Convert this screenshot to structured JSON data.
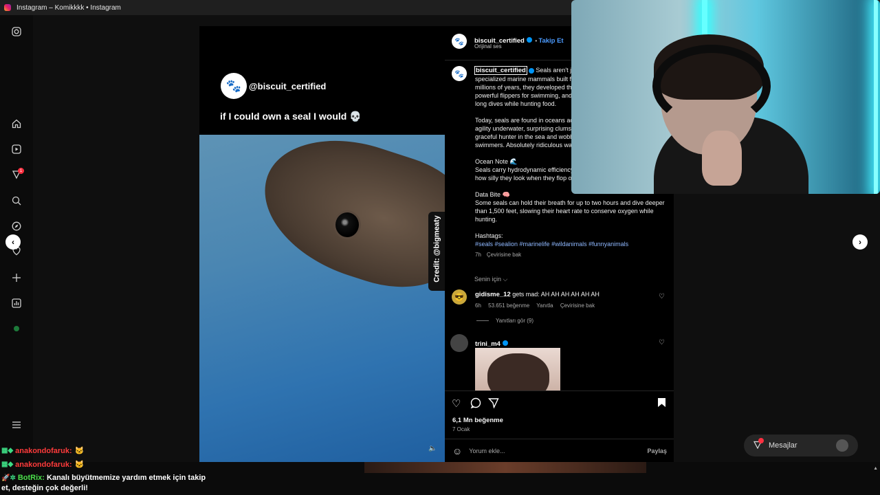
{
  "window": {
    "title": "Instagram – Komikkkk • Instagram"
  },
  "sidebar": {
    "icons": [
      "instagram-icon",
      "home-icon",
      "reels-icon",
      "heart-icon",
      "search-icon",
      "explore-icon",
      "notifications-icon",
      "create-icon",
      "dashboard-icon",
      "profile-icon",
      "menu-icon"
    ],
    "badge": "1"
  },
  "post": {
    "media": {
      "handle": "@biscuit_certified",
      "caption": "if I could own a seal I would 💀",
      "credit": "Credit: @bigmeaty"
    },
    "header": {
      "username": "biscuit_certified",
      "follow_label": "Takip Et",
      "audio": "Orijinal ses"
    },
    "caption": {
      "username": "biscuit_certified",
      "p1": "Seals aren't just adorable—they're highly specialized marine mammals built for life in open water. Evolving over millions of years, they developed thick layers of blubber for insulation, powerful flippers for swimming, and the ability to hold their breath for long dives while hunting food.",
      "p2": "Today, seals are found in oceans across the world, known for their agility underwater, surprising clumsiness on land, and balance between graceful hunter in the sea and wobbly loaf on land. Effortless swimmers. Absolutely ridiculous walkers.",
      "p3_title": "Ocean Note 🌊",
      "p3": "Seals carry hydrodynamic efficiency in the water with zero concern for how silly they look when they flop onto shore.",
      "p4_title": "Data Bite 🧠",
      "p4": "Some seals can hold their breath for up to two hours and dive deeper than 1,500 feet, slowing their heart rate to conserve oxygen while hunting.",
      "hashtags_label": "Hashtags:",
      "hashtags": "#seals #sealion #marinelife #wildanimals #funnyanimals",
      "time": "7h",
      "translate": "Çevirisine bak"
    },
    "sort_label": "Senin için",
    "comments": [
      {
        "username": "gidisme_12",
        "text": "gets mad: AH AH AH AH AH AH",
        "time": "6h",
        "likes": "53.651 beğenme",
        "reply": "Yanıtla",
        "translate": "Çevirisine bak",
        "replies": "Yanıtları gör (9)"
      },
      {
        "username": "trini_m4"
      }
    ],
    "likes": "6,1 Mn beğenme",
    "date": "7 Ocak",
    "comment_placeholder": "Yorum ekle...",
    "share_label": "Paylaş"
  },
  "messages": {
    "label": "Mesajlar",
    "badge": "1"
  },
  "chat": [
    {
      "user": "anakondofaruk:",
      "message": "🐱"
    },
    {
      "user": "anakondofaruk:",
      "message": "🐱"
    },
    {
      "user": "BotRix:",
      "message": "Kanalı büyütmemize yardım etmek için takip et, desteğin çok değerli!"
    }
  ],
  "colors": {
    "accent": "#0095f6",
    "follow": "#4c9bff",
    "hashtag": "#8fb8ff",
    "badge": "#ff3040"
  }
}
